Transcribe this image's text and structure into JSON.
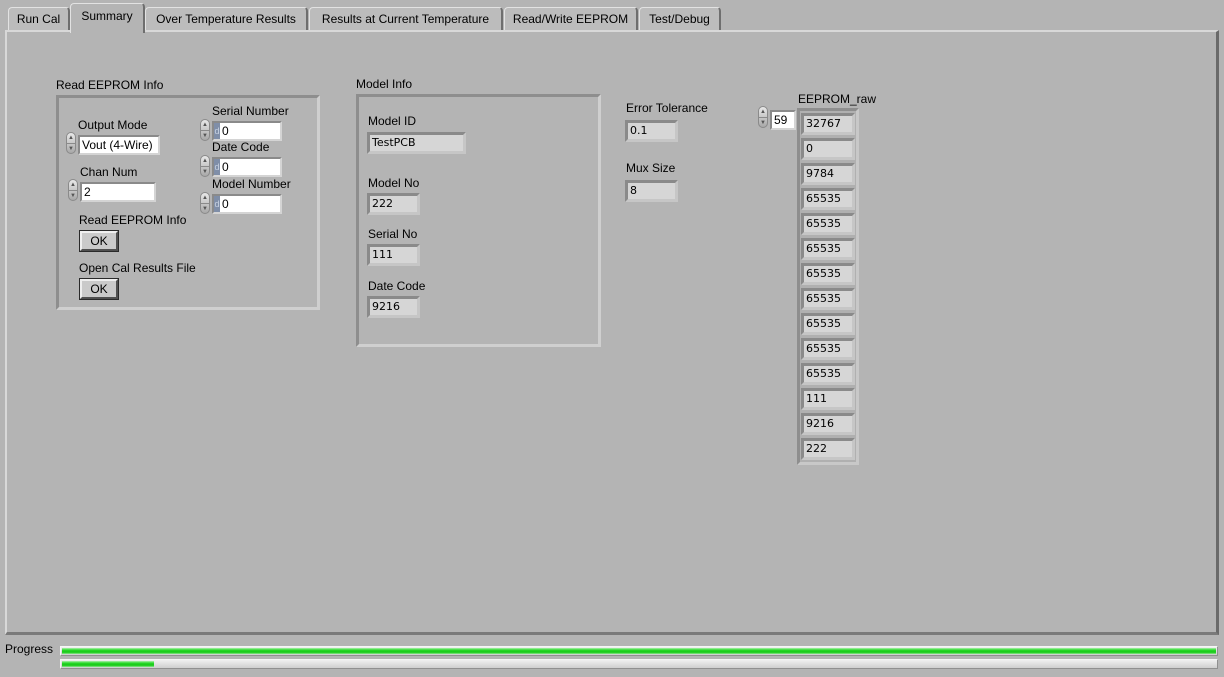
{
  "tabs": [
    {
      "label": "Run Cal",
      "active": false
    },
    {
      "label": "Summary",
      "active": true
    },
    {
      "label": "Over Temperature Results",
      "active": false
    },
    {
      "label": "Results at Current Temperature",
      "active": false
    },
    {
      "label": "Read/Write EEPROM",
      "active": false
    },
    {
      "label": "Test/Debug",
      "active": false
    }
  ],
  "read_eeprom": {
    "title": "Read EEPROM Info",
    "output_mode": {
      "label": "Output Mode",
      "value": "Vout (4-Wire)"
    },
    "chan_num": {
      "label": "Chan Num",
      "value": "2"
    },
    "serial_number": {
      "label": "Serial Number",
      "radix": "d",
      "value": "0"
    },
    "date_code": {
      "label": "Date Code",
      "radix": "d",
      "value": "0"
    },
    "model_number": {
      "label": "Model Number",
      "radix": "d",
      "value": "0"
    },
    "read_button": {
      "label": "Read EEPROM Info",
      "button": "OK"
    },
    "open_button": {
      "label": "Open Cal Results File",
      "button": "OK"
    }
  },
  "model_info": {
    "title": "Model Info",
    "model_id": {
      "label": "Model ID",
      "value": "TestPCB"
    },
    "model_no": {
      "label": "Model No",
      "value": "222"
    },
    "serial_no": {
      "label": "Serial No",
      "value": "111"
    },
    "date_code": {
      "label": "Date Code",
      "value": "9216"
    }
  },
  "error_tolerance": {
    "label": "Error Tolerance",
    "value": "0.1"
  },
  "mux_size": {
    "label": "Mux Size",
    "value": "8"
  },
  "eeprom_raw": {
    "label": "EEPROM_raw",
    "index": "59",
    "values": [
      "32767",
      "0",
      "9784",
      "65535",
      "65535",
      "65535",
      "65535",
      "65535",
      "65535",
      "65535",
      "65535",
      "111",
      "9216",
      "222"
    ]
  },
  "progress": {
    "label": "Progress",
    "bars": [
      {
        "fraction": 1.0
      },
      {
        "fraction": 0.08
      }
    ],
    "fill_color": "#1ecf1e"
  }
}
